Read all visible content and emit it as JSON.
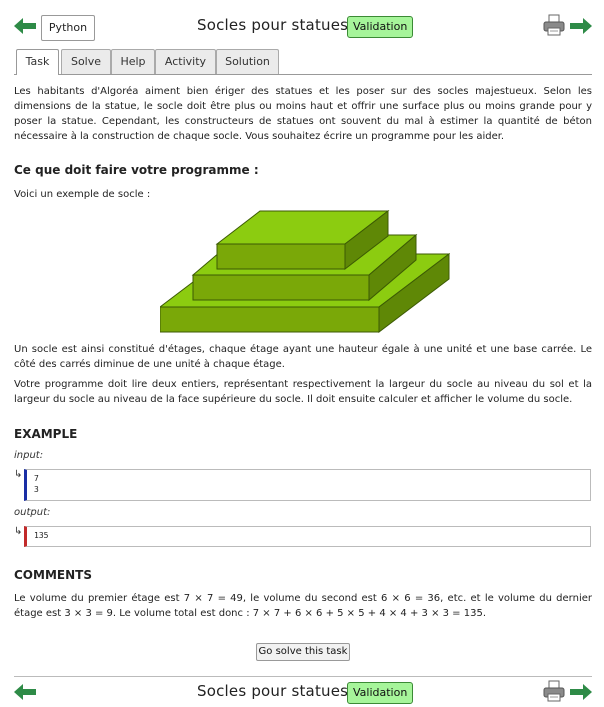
{
  "header": {
    "language": "Python",
    "title": "Socles pour statues",
    "validation": "Validation"
  },
  "tabs": [
    {
      "label": "Task"
    },
    {
      "label": "Solve"
    },
    {
      "label": "Help"
    },
    {
      "label": "Activity"
    },
    {
      "label": "Solution"
    }
  ],
  "task": {
    "intro": "Les habitants d'Algoréa aiment bien ériger des statues et les poser sur des socles majestueux. Selon les dimensions de la statue, le socle doit être plus ou moins haut et offrir une surface plus ou moins grande pour y poser la statue. Cependant, les constructeurs de statues ont souvent du mal à estimer la quantité de béton nécessaire à la construction de chaque socle. Vous souhaitez écrire un programme pour les aider.",
    "heading": "Ce que doit faire votre programme :",
    "example_intro": "Voici un exemple de socle :",
    "para2": "Un socle est ainsi constitué d'étages, chaque étage ayant une hauteur égale à une unité et une base carrée. Le côté des carrés diminue de une unité à chaque étage.",
    "para3": "Votre programme doit lire deux entiers, représentant respectivement la largeur du socle au niveau du sol et la largeur du socle au niveau de la face supérieure du socle. Il doit ensuite calculer et afficher le volume du socle."
  },
  "example": {
    "heading": "EXAMPLE",
    "input_label": "input:",
    "input_line1": "7",
    "input_line2": "3",
    "output_label": "output:",
    "output_value": "135",
    "corner": "↳"
  },
  "comments": {
    "heading": "COMMENTS",
    "text": "Le volume du premier étage est 7 × 7 = 49, le volume du second est 6 × 6 = 36, etc. et le volume du dernier étage est 3 × 3 = 9. Le volume total est donc : 7 × 7 + 6 × 6 + 5 × 5 + 4 × 4 + 3 × 3 = 135."
  },
  "go_button": "Go solve this task",
  "footer": {
    "title": "Socles pour statues",
    "validation": "Validation"
  },
  "icons": {
    "prev": "arrow-left-icon",
    "next": "arrow-right-icon",
    "print": "printer-icon"
  },
  "colors": {
    "arrow": "#2e8b47",
    "validation_bg": "#a6f59a",
    "pedestal_top": "#8ccc10",
    "pedestal_front": "#7aa808",
    "pedestal_side": "#5f8806"
  }
}
